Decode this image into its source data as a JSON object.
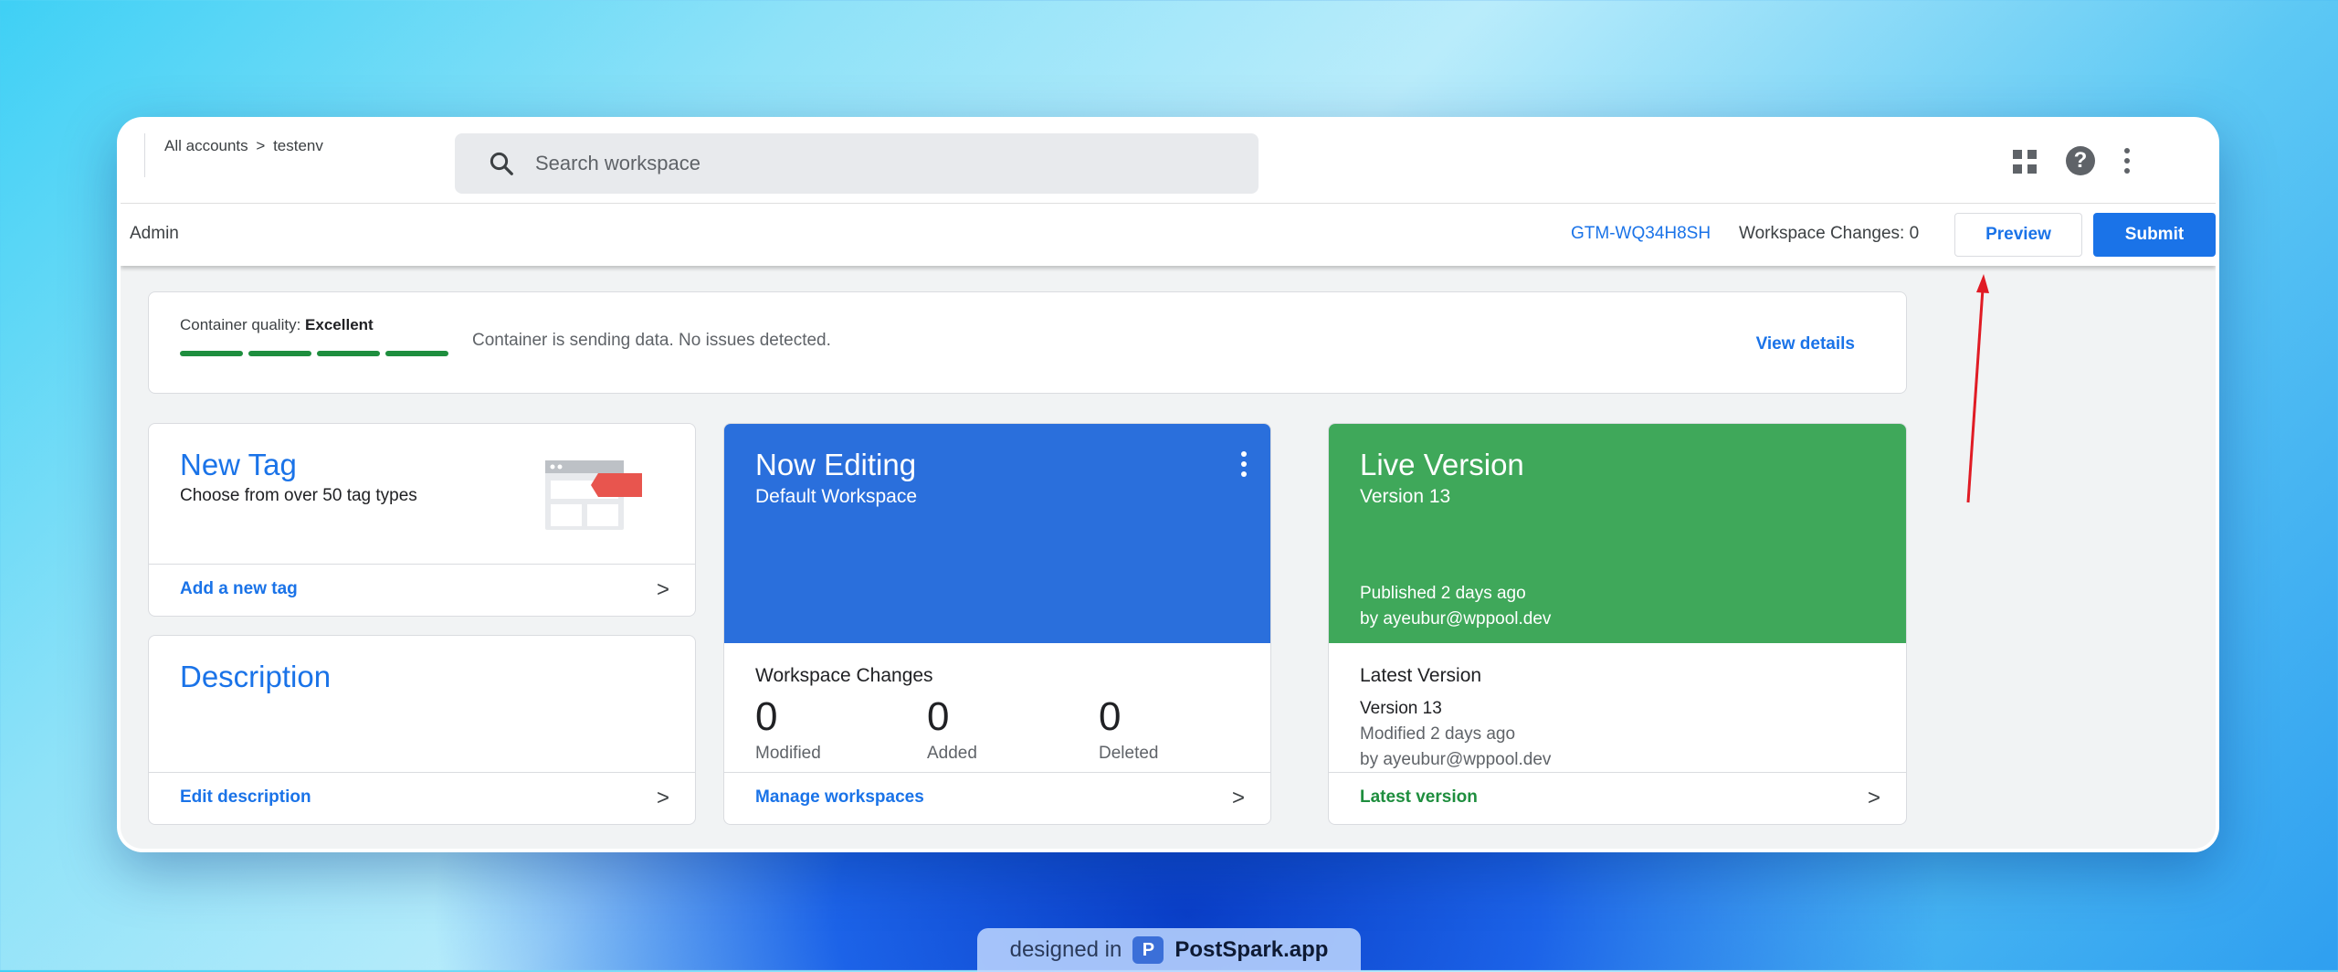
{
  "topbar": {
    "breadcrumb_root": "All accounts",
    "breadcrumb_sep": ">",
    "breadcrumb_current": "testenv",
    "search_placeholder": "Search workspace",
    "help_glyph": "?"
  },
  "subbar": {
    "admin_label": "Admin",
    "container_id": "GTM-WQ34H8SH",
    "workspace_changes": "Workspace Changes: 0",
    "preview_label": "Preview",
    "submit_label": "Submit"
  },
  "quality": {
    "label": "Container quality:",
    "value": "Excellent",
    "segments": 4,
    "message": "Container is sending data. No issues detected.",
    "link": "View details",
    "color": "#1e8e3e"
  },
  "new_tag": {
    "title": "New Tag",
    "subtitle": "Choose from over 50 tag types",
    "link": "Add a new tag"
  },
  "description": {
    "title": "Description",
    "link": "Edit description"
  },
  "now_editing": {
    "title": "Now Editing",
    "subtitle": "Default Workspace",
    "changes_title": "Workspace Changes",
    "stats": [
      {
        "value": "0",
        "label": "Modified"
      },
      {
        "value": "0",
        "label": "Added"
      },
      {
        "value": "0",
        "label": "Deleted"
      }
    ],
    "link": "Manage workspaces",
    "color": "#2a6fdc"
  },
  "live_version": {
    "title": "Live Version",
    "subtitle": "Version 13",
    "published": "Published 2 days ago",
    "published_by": "by ayeubur@wppool.dev",
    "latest_title": "Latest Version",
    "latest_version": "Version 13",
    "latest_modified": "Modified 2 days ago",
    "latest_by": "by ayeubur@wppool.dev",
    "link": "Latest version",
    "color": "#3fa85a"
  },
  "chevron": ">",
  "badge": {
    "prefix": "designed in",
    "logo": "P",
    "brand": "PostSpark.app"
  }
}
